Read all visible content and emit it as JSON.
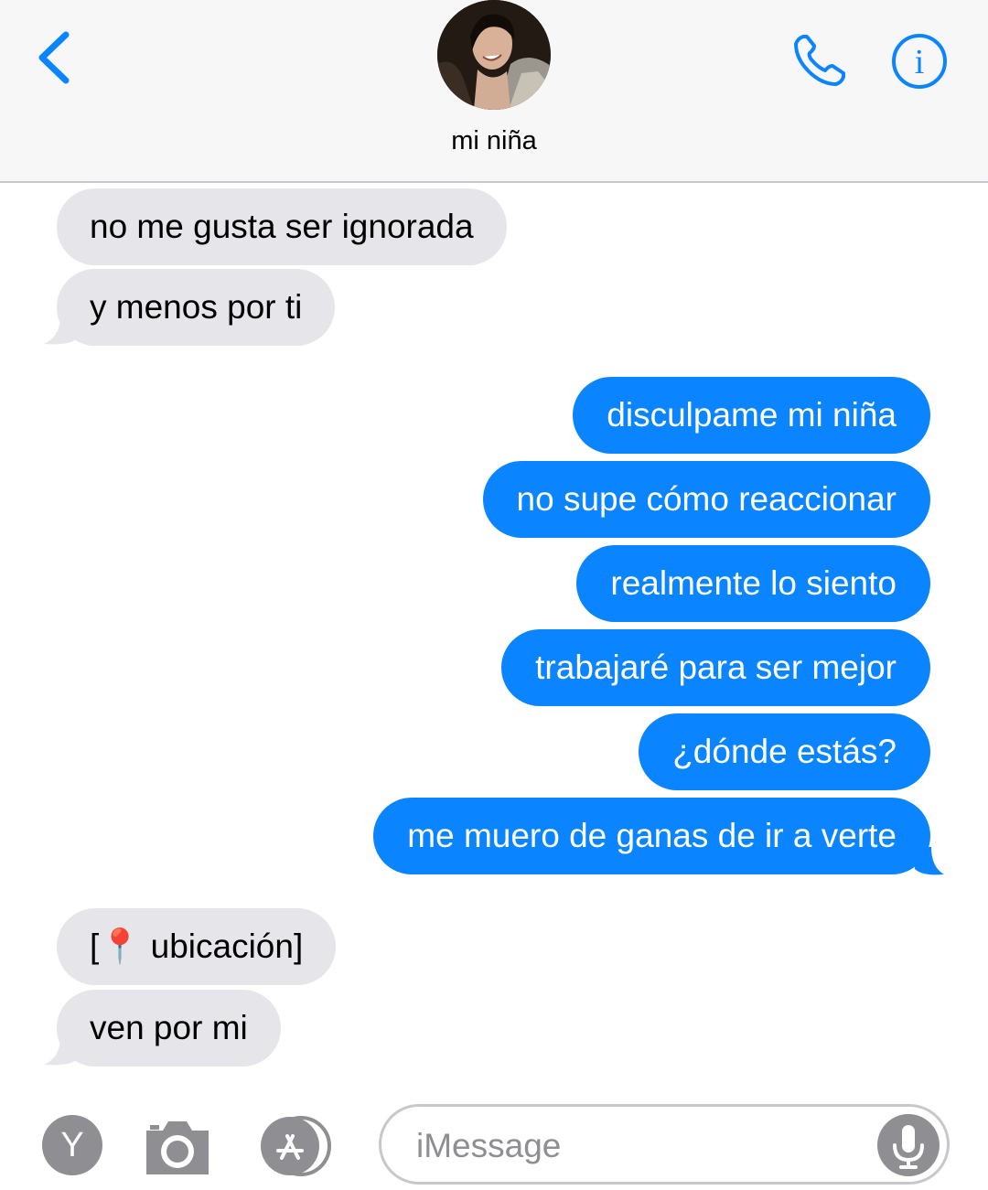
{
  "header": {
    "contact_name": "mi niña",
    "back_icon": "chevron-left-icon",
    "call_icon": "phone-icon",
    "info_icon": "info-icon",
    "info_glyph": "i",
    "accent_color": "#0b84ff"
  },
  "messages": [
    {
      "from": "them",
      "text": "no me gusta ser ignorada"
    },
    {
      "from": "them",
      "text": "y menos por ti"
    },
    {
      "from": "me",
      "text": "disculpame mi niña"
    },
    {
      "from": "me",
      "text": "no supe cómo reaccionar"
    },
    {
      "from": "me",
      "text": "realmente lo siento"
    },
    {
      "from": "me",
      "text": "trabajaré para ser mejor"
    },
    {
      "from": "me",
      "text": "¿dónde estás?"
    },
    {
      "from": "me",
      "text": "me muero de ganas de ir a verte"
    },
    {
      "from": "them",
      "text": "[📍 ubicación]"
    },
    {
      "from": "them",
      "text": "ven por mi"
    }
  ],
  "composer": {
    "placeholder": "iMessage",
    "y_button_label": "Y",
    "camera_icon": "camera-icon",
    "appstore_icon": "app-store-icon",
    "mic_icon": "microphone-icon"
  }
}
